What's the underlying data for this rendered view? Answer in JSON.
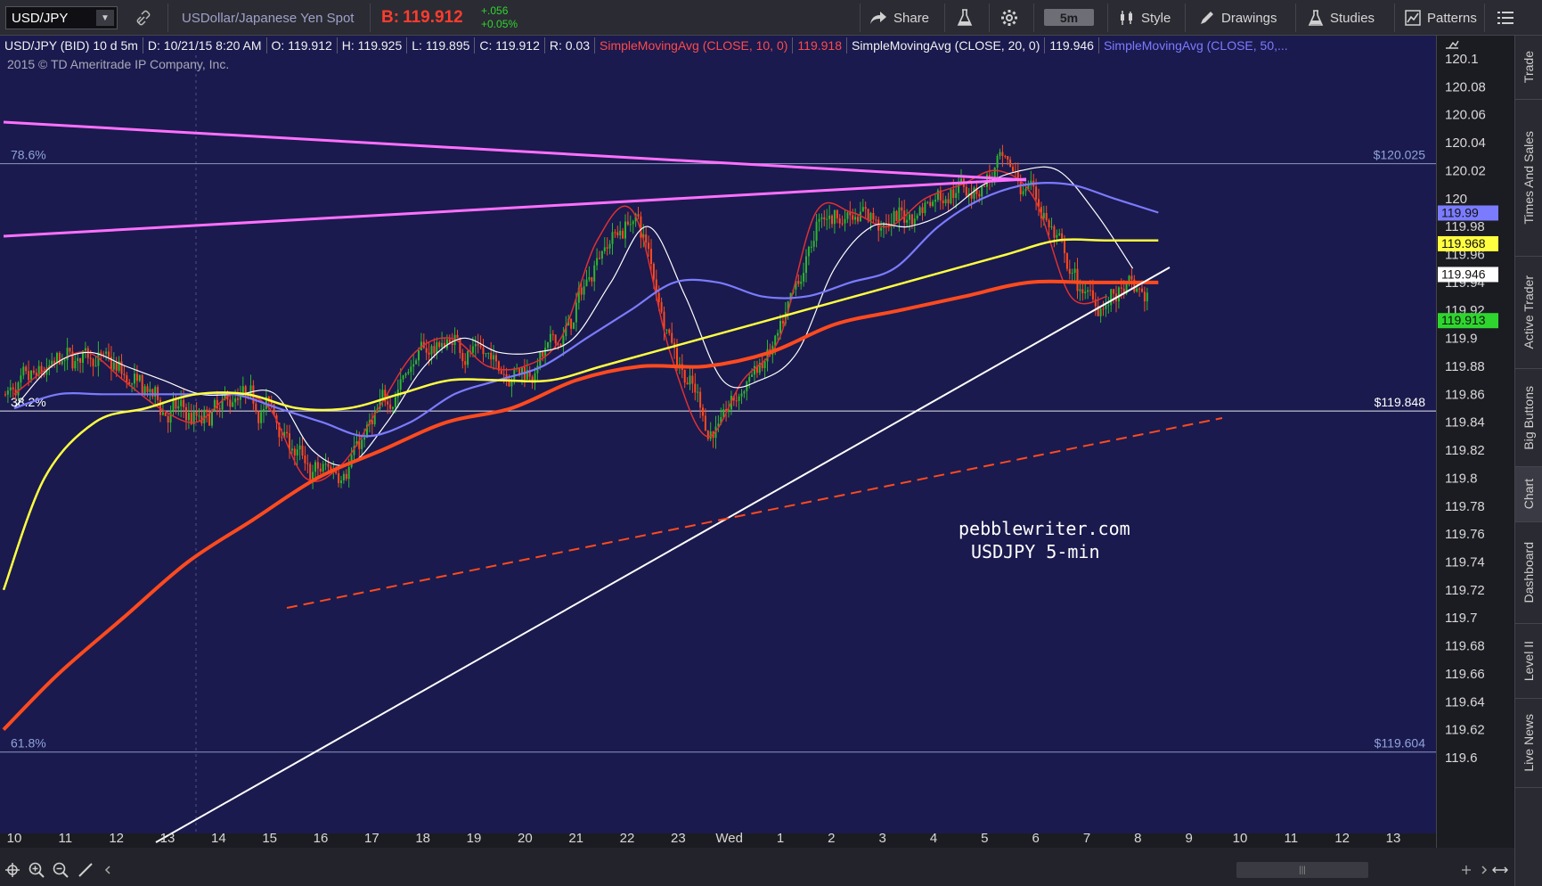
{
  "toolbar": {
    "symbol": "USD/JPY",
    "description": "USDollar/Japanese Yen Spot",
    "bid_label": "B:",
    "bid_value": "119.912",
    "change_abs": "+.056",
    "change_pct": "+0.05%",
    "share_label": "Share",
    "timeframe_label": "5m",
    "style_label": "Style",
    "drawings_label": "Drawings",
    "studies_label": "Studies",
    "patterns_label": "Patterns"
  },
  "infobar": {
    "symbol_desc": "USD/JPY (BID) 10 d 5m",
    "date": "D: 10/21/15 8:20 AM",
    "open": "O: 119.912",
    "high": "H: 119.925",
    "low": "L: 119.895",
    "close": "C: 119.912",
    "range": "R: 0.03",
    "sma10_label": "SimpleMovingAvg (CLOSE, 10, 0)",
    "sma10_value": "119.918",
    "sma20_label": "SimpleMovingAvg (CLOSE, 20, 0)",
    "sma20_value": "119.946",
    "sma50_label": "SimpleMovingAvg (CLOSE, 50,..."
  },
  "copyright": "2015 © TD Ameritrade IP Company, Inc.",
  "watermark_line1": "pebblewriter.com",
  "watermark_line2": "USDJPY 5-min",
  "right_tabs": [
    "Trade",
    "Times And Sales",
    "Active Trader",
    "Big Buttons",
    "Chart",
    "Dashboard",
    "Level II",
    "Live News"
  ],
  "colors": {
    "background": "#1a1a4e",
    "up_candle": "#2fb52f",
    "down_candle": "#ff4a1e",
    "sma10": "#e03030",
    "sma20": "#ffffff",
    "sma50": "#7b7bff",
    "sma100": "#ffff40",
    "sma200": "#ff4a1e",
    "trendline_pink": "#ff70ff",
    "bid_text": "#ff3c2e",
    "change_text": "#2fd52f"
  },
  "chart_data": {
    "type": "candlestick",
    "ylim": [
      119.6,
      120.1
    ],
    "yticks": [
      "120.1",
      "120.08",
      "120.06",
      "120.04",
      "120.02",
      "120",
      "119.98",
      "119.96",
      "119.94",
      "119.92",
      "119.9",
      "119.88",
      "119.86",
      "119.84",
      "119.82",
      "119.8",
      "119.78",
      "119.76",
      "119.74",
      "119.72",
      "119.7",
      "119.68",
      "119.66",
      "119.64",
      "119.62",
      "119.6"
    ],
    "xticks": [
      "10",
      "11",
      "12",
      "13",
      "14",
      "15",
      "16",
      "17",
      "18",
      "19",
      "20",
      "21",
      "22",
      "23",
      "Wed",
      "1",
      "2",
      "3",
      "4",
      "5",
      "6",
      "7",
      "8",
      "9",
      "10",
      "11",
      "12",
      "13"
    ],
    "fib_levels": [
      {
        "label": "78.6%",
        "value": 120.025,
        "value_text": "$120.025"
      },
      {
        "label": "38.2%",
        "value": 119.848,
        "value_text": "$119.848"
      },
      {
        "label": "61.8%",
        "value": 119.604,
        "value_text": "$119.604"
      }
    ],
    "price_tags": [
      {
        "text": "119.99",
        "value": 119.99,
        "color": "#7b7bff"
      },
      {
        "text": "119.968",
        "value": 119.968,
        "color": "#ffff40"
      },
      {
        "text": "119.946",
        "value": 119.946,
        "color": "#ffffff"
      },
      {
        "text": "119.913",
        "value": 119.913,
        "color": "#2fd52f"
      }
    ],
    "series": [
      {
        "name": "SimpleMovingAvg (CLOSE, 10, 0)",
        "values": [
          119.86,
          119.88,
          119.89,
          119.87,
          119.85,
          119.84,
          119.86,
          119.85,
          119.8,
          119.81,
          119.85,
          119.89,
          119.9,
          119.88,
          119.88,
          119.9,
          119.97,
          119.99,
          119.89,
          119.83,
          119.87,
          119.9,
          119.99,
          119.99,
          119.98,
          120.0,
          120.01,
          120.02,
          120.0,
          119.93,
          119.93
        ]
      },
      {
        "name": "SimpleMovingAvg (CLOSE, 20, 0)",
        "values": [
          119.85,
          119.88,
          119.89,
          119.88,
          119.87,
          119.86,
          119.86,
          119.86,
          119.82,
          119.81,
          119.84,
          119.88,
          119.9,
          119.89,
          119.89,
          119.9,
          119.94,
          119.98,
          119.93,
          119.87,
          119.87,
          119.89,
          119.95,
          119.98,
          119.98,
          119.99,
          120.01,
          120.02,
          120.02,
          119.99,
          119.95
        ]
      },
      {
        "name": "SimpleMovingAvg (CLOSE, 50, 0)",
        "values": [
          119.85,
          119.86,
          119.86,
          119.86,
          119.86,
          119.86,
          119.85,
          119.84,
          119.83,
          119.84,
          119.86,
          119.87,
          119.88,
          119.9,
          119.92,
          119.94,
          119.94,
          119.93,
          119.93,
          119.94,
          119.95,
          119.98,
          120.0,
          120.01,
          120.01,
          120.0,
          119.99
        ]
      },
      {
        "name": "SMA 100",
        "values": [
          119.72,
          119.8,
          119.84,
          119.85,
          119.86,
          119.86,
          119.85,
          119.85,
          119.86,
          119.87,
          119.87,
          119.87,
          119.88,
          119.89,
          119.9,
          119.91,
          119.92,
          119.93,
          119.94,
          119.95,
          119.96,
          119.97,
          119.97,
          119.97
        ]
      },
      {
        "name": "SMA 200",
        "values": [
          119.62,
          119.66,
          119.7,
          119.74,
          119.77,
          119.8,
          119.82,
          119.84,
          119.85,
          119.87,
          119.88,
          119.88,
          119.89,
          119.91,
          119.92,
          119.93,
          119.94,
          119.94,
          119.94
        ]
      }
    ]
  }
}
